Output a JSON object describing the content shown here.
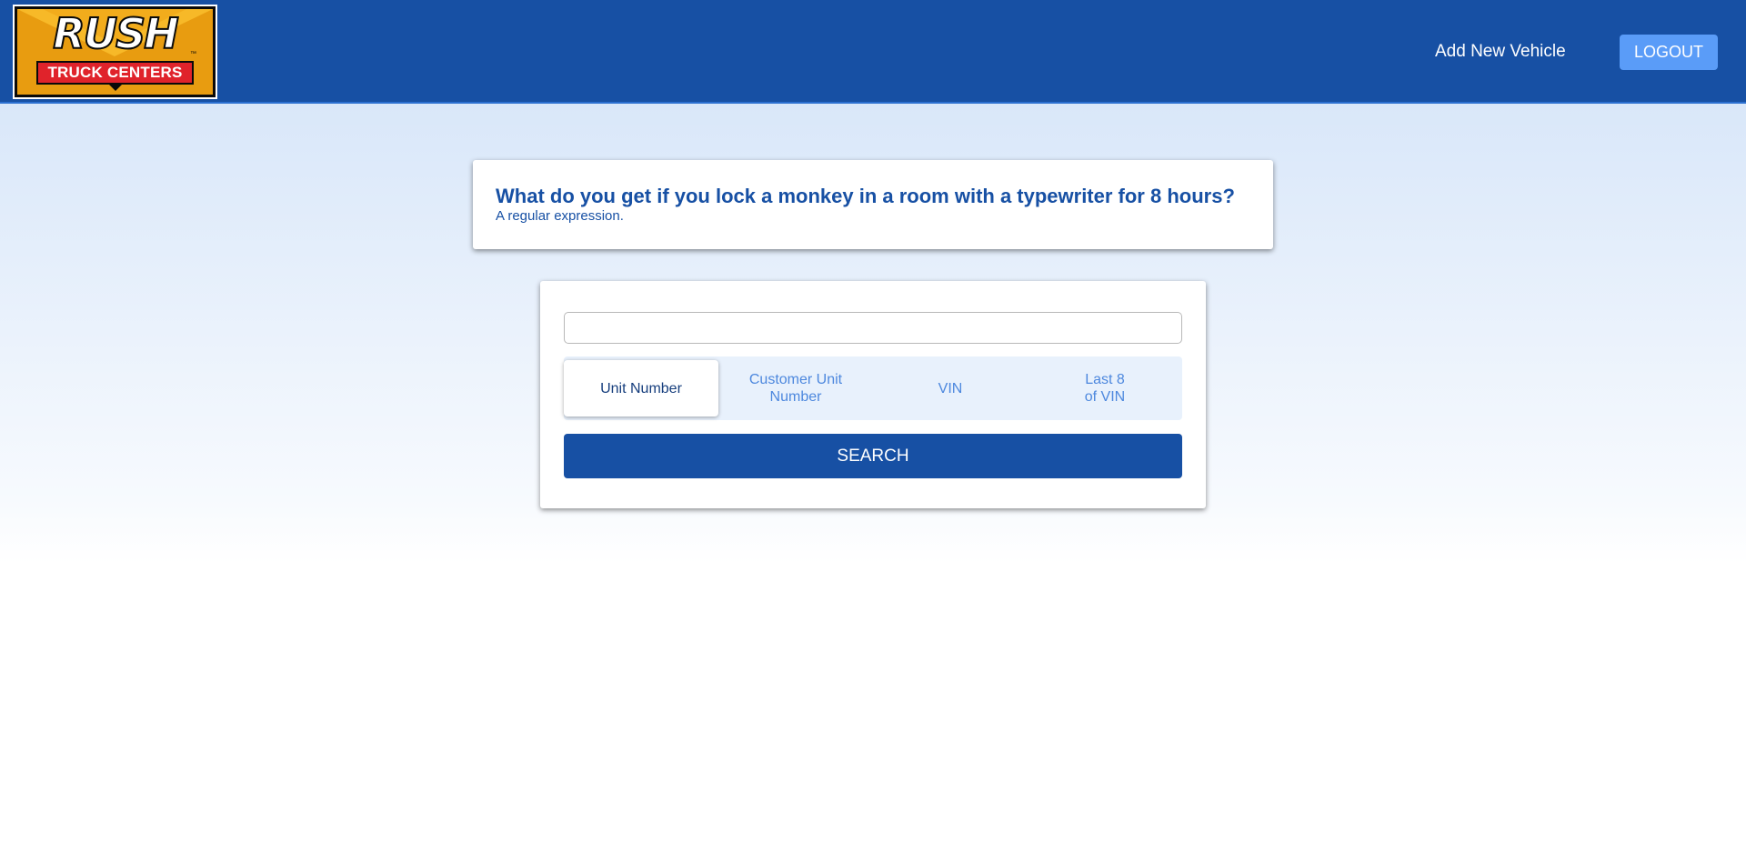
{
  "header": {
    "logo": {
      "wordmark": "RUSH",
      "trademark": "™",
      "banner": "TRUCK CENTERS"
    },
    "add_vehicle_label": "Add New Vehicle",
    "logout_label": "LOGOUT"
  },
  "joke": {
    "question": "What do you get if you lock a monkey in a room with a typewriter for 8 hours?",
    "answer": "A regular expression."
  },
  "search": {
    "input_value": "",
    "input_placeholder": "",
    "types": [
      {
        "label": "Unit Number",
        "selected": true
      },
      {
        "label": "Customer Unit Number",
        "selected": false
      },
      {
        "label": "VIN",
        "selected": false
      },
      {
        "label": "Last 8 of VIN",
        "selected": false
      }
    ],
    "button_label": "SEARCH"
  },
  "colors": {
    "brand_blue": "#1750a4",
    "logout_blue": "#5a9cf8",
    "segment_bg": "#e8f1fc",
    "segment_text": "#4d88de",
    "logo_yellow": "#f2ac1c",
    "logo_red": "#e0232b"
  }
}
